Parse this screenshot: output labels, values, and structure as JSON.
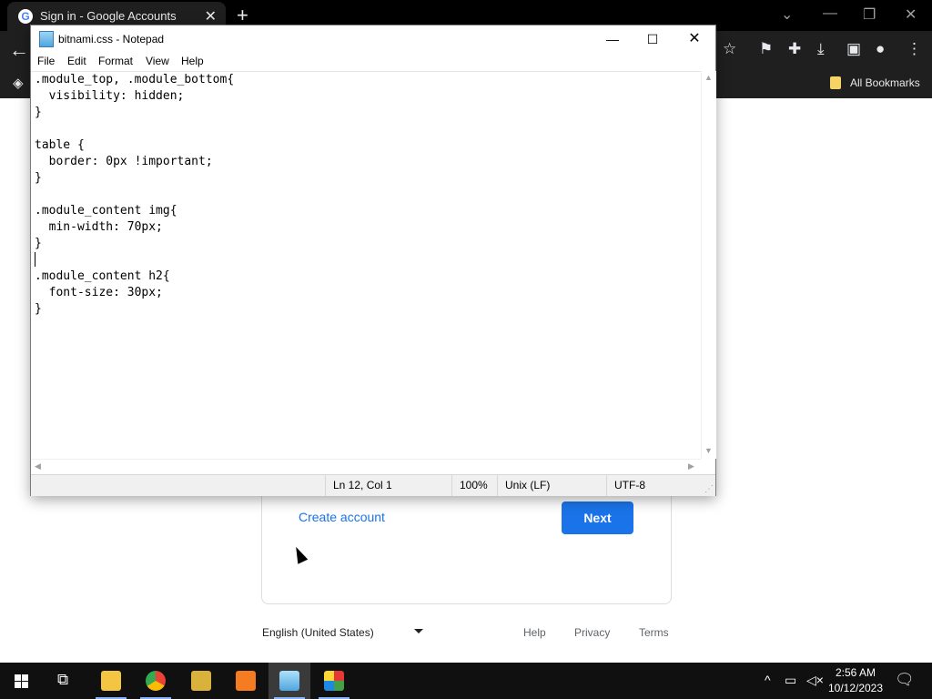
{
  "browser": {
    "tab_title": "Sign in - Google Accounts",
    "tab_favicon": "G",
    "new_tab_glyph": "+",
    "close_glyph": "✕",
    "bookmarks_label": "All Bookmarks"
  },
  "signin": {
    "create_account": "Create account",
    "next_label": "Next",
    "language": "English (United States)",
    "footer_links": [
      "Help",
      "Privacy",
      "Terms"
    ],
    "accent_color": "#1a73e8"
  },
  "notepad": {
    "title": "bitnami.css - Notepad",
    "menu": [
      "File",
      "Edit",
      "Format",
      "View",
      "Help"
    ],
    "content": ".module_top, .module_bottom{\n  visibility: hidden;\n}\n\ntable {\n  border: 0px !important;\n}\n\n.module_content img{\n  min-width: 70px;\n}\n\n.module_content h2{\n  font-size: 30px;\n}",
    "status": {
      "position": "Ln 12, Col 1",
      "zoom": "100%",
      "line_ending": "Unix (LF)",
      "encoding": "UTF-8"
    }
  },
  "taskbar": {
    "time": "2:56 AM",
    "date": "10/12/2023",
    "apps": [
      "file-explorer-icon",
      "chrome-icon",
      "hornet-icon",
      "xampp-icon",
      "notepad-icon",
      "paint-icon"
    ]
  }
}
